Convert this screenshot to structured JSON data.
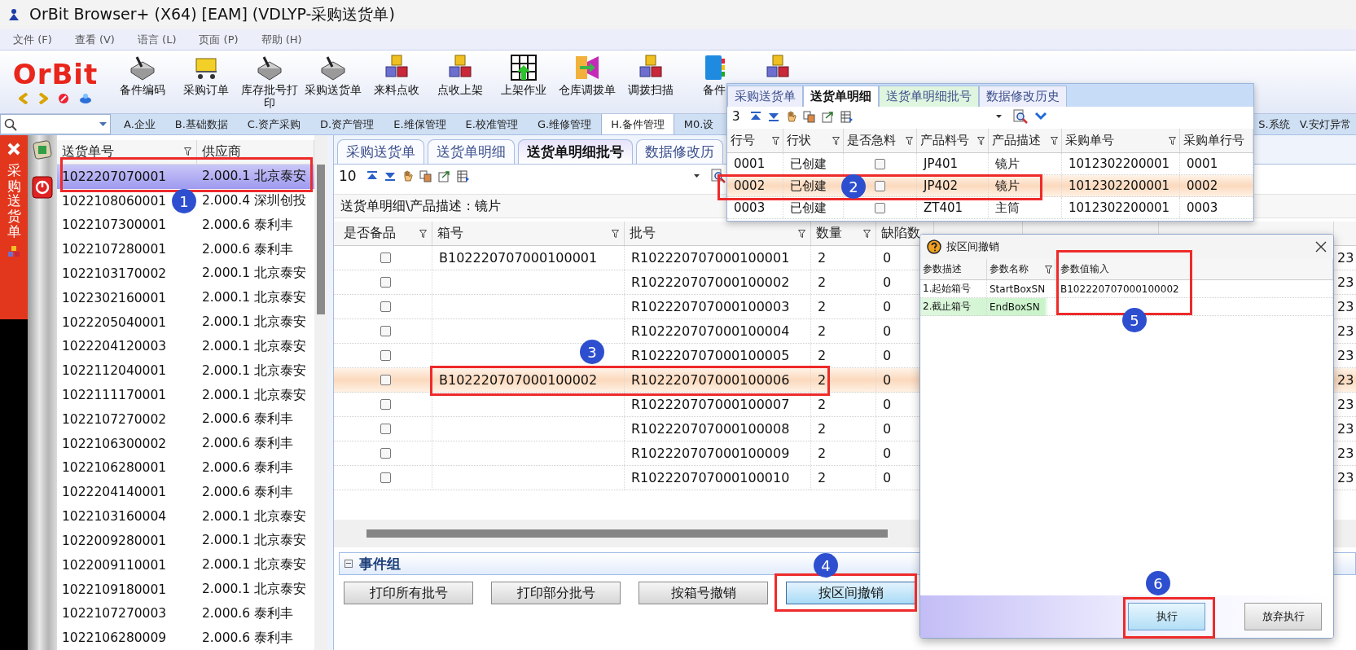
{
  "window": {
    "title": "OrBit Browser+ (X64) [EAM] (VDLYP-采购送货单)"
  },
  "menu": [
    "文件 (F)",
    "查看 (V)",
    "语言 (L)",
    "页面 (P)",
    "帮助 (H)"
  ],
  "logo": "OrBit",
  "toolbar": [
    {
      "label": "备件编码"
    },
    {
      "label": "采购订单"
    },
    {
      "label": "库存批号打印"
    },
    {
      "label": "采购送货单"
    },
    {
      "label": "来料点收"
    },
    {
      "label": "点收上架"
    },
    {
      "label": "上架作业"
    },
    {
      "label": "仓库调拨单"
    },
    {
      "label": "调拨扫描"
    },
    {
      "label": "备件"
    }
  ],
  "module_tabs": [
    {
      "label": "A.企业",
      "selected": false
    },
    {
      "label": "B.基础数据",
      "selected": false
    },
    {
      "label": "C.资产采购",
      "selected": false
    },
    {
      "label": "D.资产管理",
      "selected": false
    },
    {
      "label": "E.维保管理",
      "selected": false
    },
    {
      "label": "E.校准管理",
      "selected": false
    },
    {
      "label": "G.维修管理",
      "selected": false
    },
    {
      "label": "H.备件管理",
      "selected": true
    },
    {
      "label": "M0.设",
      "selected": false
    }
  ],
  "module_tabs_right": [
    {
      "label": "S.系统",
      "selected": false
    },
    {
      "label": "V.安灯异常",
      "selected": false
    }
  ],
  "side_panel": {
    "title": "采购送货单"
  },
  "order_list": {
    "columns": [
      {
        "label": "送货单号",
        "filter": true
      },
      {
        "label": "供应商",
        "filter": false
      }
    ],
    "rows": [
      {
        "number": "1022207070001",
        "supplier": "2.000.1 北京泰安",
        "selected": true
      },
      {
        "number": "1022108060001",
        "supplier": "2.000.4 深圳创投",
        "selected": false
      },
      {
        "number": "1022107300001",
        "supplier": "2.000.6 泰利丰",
        "selected": false
      },
      {
        "number": "1022107280001",
        "supplier": "2.000.6 泰利丰",
        "selected": false
      },
      {
        "number": "1022103170002",
        "supplier": "2.000.1 北京泰安",
        "selected": false
      },
      {
        "number": "1022302160001",
        "supplier": "2.000.1 北京泰安",
        "selected": false
      },
      {
        "number": "1022205040001",
        "supplier": "2.000.1 北京泰安",
        "selected": false
      },
      {
        "number": "1022204120003",
        "supplier": "2.000.1 北京泰安",
        "selected": false
      },
      {
        "number": "1022112040001",
        "supplier": "2.000.1 北京泰安",
        "selected": false
      },
      {
        "number": "1022111170001",
        "supplier": "2.000.1 北京泰安",
        "selected": false
      },
      {
        "number": "1022107270002",
        "supplier": "2.000.6 泰利丰",
        "selected": false
      },
      {
        "number": "1022106300002",
        "supplier": "2.000.6 泰利丰",
        "selected": false
      },
      {
        "number": "1022106280001",
        "supplier": "2.000.6 泰利丰",
        "selected": false
      },
      {
        "number": "1022204140001",
        "supplier": "2.000.6 泰利丰",
        "selected": false
      },
      {
        "number": "1022103160004",
        "supplier": "2.000.1 北京泰安",
        "selected": false
      },
      {
        "number": "1022009280001",
        "supplier": "2.000.1 北京泰安",
        "selected": false
      },
      {
        "number": "1022009110001",
        "supplier": "2.000.1 北京泰安",
        "selected": false
      },
      {
        "number": "1022109180001",
        "supplier": "2.000.1 北京泰安",
        "selected": false
      },
      {
        "number": "1022107270003",
        "supplier": "2.000.6 泰利丰",
        "selected": false
      },
      {
        "number": "1022106280009",
        "supplier": "2.000.6 泰利丰",
        "selected": false
      }
    ]
  },
  "main": {
    "tabs": [
      {
        "label": "采购送货单",
        "selected": false
      },
      {
        "label": "送货单明细",
        "selected": false
      },
      {
        "label": "送货单明细批号",
        "selected": true
      },
      {
        "label": "数据修改历",
        "selected": false
      }
    ],
    "record_count": "10",
    "breadcrumb": "送货单明细\\产品描述 : 镜片",
    "columns": [
      {
        "label": "是否备品",
        "filter": true
      },
      {
        "label": "箱号",
        "filter": true
      },
      {
        "label": "批号",
        "filter": true
      },
      {
        "label": "数量",
        "filter": true
      },
      {
        "label": "缺陷数",
        "filter": false
      }
    ],
    "rows": [
      {
        "checked": false,
        "selected": false,
        "box": "B102220707000100001",
        "batch": "R102220707000100001",
        "quantity": "2",
        "defects": "0",
        "column_9": "23"
      },
      {
        "checked": false,
        "selected": false,
        "batch": "R102220707000100002",
        "quantity": "2",
        "defects": "0",
        "column_9": "23"
      },
      {
        "checked": false,
        "selected": false,
        "batch": "R102220707000100003",
        "quantity": "2",
        "defects": "0",
        "column_9": "23"
      },
      {
        "checked": false,
        "selected": false,
        "batch": "R102220707000100004",
        "quantity": "2",
        "defects": "0",
        "column_9": "23"
      },
      {
        "checked": false,
        "selected": false,
        "batch": "R102220707000100005",
        "quantity": "2",
        "defects": "0",
        "column_9": "23"
      },
      {
        "checked": false,
        "selected": true,
        "box": "B102220707000100002",
        "batch": "R102220707000100006",
        "quantity": "2",
        "defects": "0",
        "column_9": "23"
      },
      {
        "checked": false,
        "selected": false,
        "batch": "R102220707000100007",
        "quantity": "2",
        "defects": "0",
        "column_9": "23"
      },
      {
        "checked": false,
        "selected": false,
        "batch": "R102220707000100008",
        "quantity": "2",
        "defects": "0",
        "column_9": "23"
      },
      {
        "checked": false,
        "selected": false,
        "batch": "R102220707000100009",
        "quantity": "2",
        "defects": "0",
        "column_9": "23"
      },
      {
        "checked": false,
        "selected": false,
        "batch": "R102220707000100010",
        "quantity": "2",
        "defects": "0",
        "column_9": "23"
      }
    ],
    "event_group": {
      "title": "事件组",
      "expanded": true,
      "buttons": [
        {
          "label": "打印所有批号",
          "selected": false
        },
        {
          "label": "打印部分批号",
          "selected": false
        },
        {
          "label": "按箱号撤销",
          "selected": false
        },
        {
          "label": "按区间撤销",
          "selected": true
        }
      ]
    }
  },
  "detail_popup": {
    "tabs": [
      {
        "label": "采购送货单",
        "selected": false
      },
      {
        "label": "送货单明细",
        "selected": true
      },
      {
        "label": "送货单明细批号",
        "selected": false
      },
      {
        "label": "数据修改历史",
        "selected": false
      }
    ],
    "record_count": "3",
    "columns": [
      {
        "label": "行号",
        "filter": true
      },
      {
        "label": "行状",
        "filter": true
      },
      {
        "label": "是否急料",
        "filter": true
      },
      {
        "label": "产品料号",
        "filter": true
      },
      {
        "label": "产品描述",
        "filter": true
      },
      {
        "label": "采购单号",
        "filter": true
      },
      {
        "label": "采购单行号",
        "filter": false
      }
    ],
    "rows": [
      {
        "line": "0001",
        "status": "已创建",
        "urgent": false,
        "part": "JP401",
        "description": "镜片",
        "po": "1012302200001",
        "po_line": "0001",
        "selected": false
      },
      {
        "line": "0002",
        "status": "已创建",
        "urgent": false,
        "part": "JP402",
        "description": "镜片",
        "po": "1012302200001",
        "po_line": "0002",
        "selected": true
      },
      {
        "line": "0003",
        "status": "已创建",
        "urgent": false,
        "part": "ZT401",
        "description": "主筒",
        "po": "1012302200001",
        "po_line": "0003",
        "selected": false
      }
    ]
  },
  "dialog": {
    "title": "按区间撤销",
    "columns": [
      {
        "label": "参数描述",
        "filter": false
      },
      {
        "label": "参数名称",
        "filter": true
      },
      {
        "label": "参数值输入",
        "filter": false
      }
    ],
    "rows": [
      {
        "description": "1.起始箱号",
        "name": "StartBoxSN",
        "value": "B102220707000100002",
        "selected": false
      },
      {
        "description": "2.截止箱号",
        "name": "EndBoxSN",
        "selected": true
      }
    ],
    "buttons": [
      {
        "label": "执行",
        "selected": true
      },
      {
        "label": "放弃执行",
        "selected": false
      }
    ]
  },
  "annotations": [
    {
      "number": "1"
    },
    {
      "number": "2"
    },
    {
      "number": "3"
    },
    {
      "number": "4"
    },
    {
      "number": "5"
    },
    {
      "number": "6"
    }
  ]
}
